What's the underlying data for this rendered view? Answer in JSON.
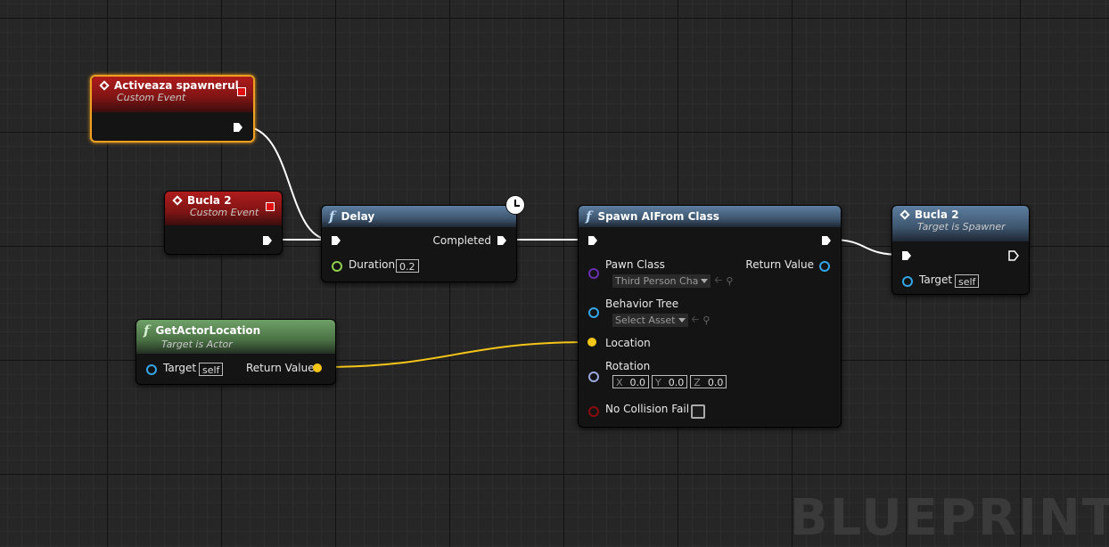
{
  "graph": {
    "watermark": "BLUEPRINT",
    "colors": {
      "background": "#262626",
      "exec_wire": "#ffffff",
      "vector_wire": "#f5c518",
      "event_header": "#b01c1c",
      "function_header": "#4e6a88",
      "pure_header": "#5a8a55",
      "selected_outline": "#f0a020"
    }
  },
  "nodes": {
    "activeaza": {
      "title": "Activeaza spawnerul",
      "subtitle": "Custom Event",
      "icon": "event-diamond-icon"
    },
    "bucla2_event": {
      "title": "Bucla 2",
      "subtitle": "Custom Event",
      "icon": "event-diamond-icon"
    },
    "delay": {
      "title": "Delay",
      "icon": "function-icon",
      "completed_label": "Completed",
      "duration_label": "Duration",
      "duration_value": "0.2"
    },
    "get_actor_location": {
      "title": "GetActorLocation",
      "subtitle": "Target is Actor",
      "target_label": "Target",
      "target_value": "self",
      "return_label": "Return Value"
    },
    "spawn_ai": {
      "title": "Spawn AIFrom Class",
      "pawn_class_label": "Pawn Class",
      "pawn_class_value": "Third Person Cha",
      "return_label": "Return Value",
      "behavior_tree_label": "Behavior Tree",
      "behavior_tree_value": "Select Asset",
      "location_label": "Location",
      "rotation_label": "Rotation",
      "rotation": {
        "x_label": "X",
        "x": "0.0",
        "y_label": "Y",
        "y": "0.0",
        "z_label": "Z",
        "z": "0.0"
      },
      "no_collision_label": "No Collision Fail"
    },
    "bucla2_call": {
      "title": "Bucla 2",
      "subtitle": "Target is Spawner",
      "target_label": "Target",
      "target_value": "self"
    }
  }
}
